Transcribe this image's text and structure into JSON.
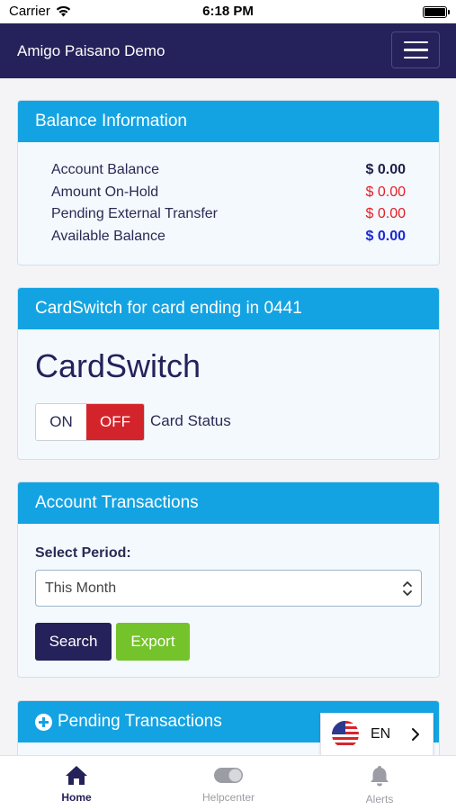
{
  "status_bar": {
    "carrier": "Carrier",
    "time": "6:18 PM"
  },
  "nav": {
    "title": "Amigo Paisano Demo"
  },
  "balance": {
    "header": "Balance Information",
    "rows": [
      {
        "label": "Account Balance",
        "value": "$ 0.00"
      },
      {
        "label": "Amount On-Hold",
        "value": "$ 0.00"
      },
      {
        "label": "Pending External Transfer",
        "value": "$ 0.00"
      },
      {
        "label": "Available Balance",
        "value": "$ 0.00"
      }
    ]
  },
  "cardswitch": {
    "header": "CardSwitch for card ending in 0441",
    "title": "CardSwitch",
    "on_label": "ON",
    "off_label": "OFF",
    "status_label": "Card Status",
    "state": "OFF"
  },
  "transactions": {
    "header": "Account Transactions",
    "period_label": "Select Period:",
    "period_value": "This Month",
    "search_label": "Search",
    "export_label": "Export"
  },
  "pending": {
    "header": "Pending Transactions"
  },
  "language": {
    "code": "EN"
  },
  "tabs": [
    {
      "label": "Home",
      "icon": "home-icon"
    },
    {
      "label": "Helpcenter",
      "icon": "toggle-icon"
    },
    {
      "label": "Alerts",
      "icon": "bell-icon"
    }
  ],
  "colors": {
    "nav_bg": "#25215a",
    "card_header": "#14a3e2",
    "off_red": "#d3242b",
    "export_green": "#74c32a",
    "negative_red": "#e21f26",
    "available_blue": "#1a29d6"
  }
}
